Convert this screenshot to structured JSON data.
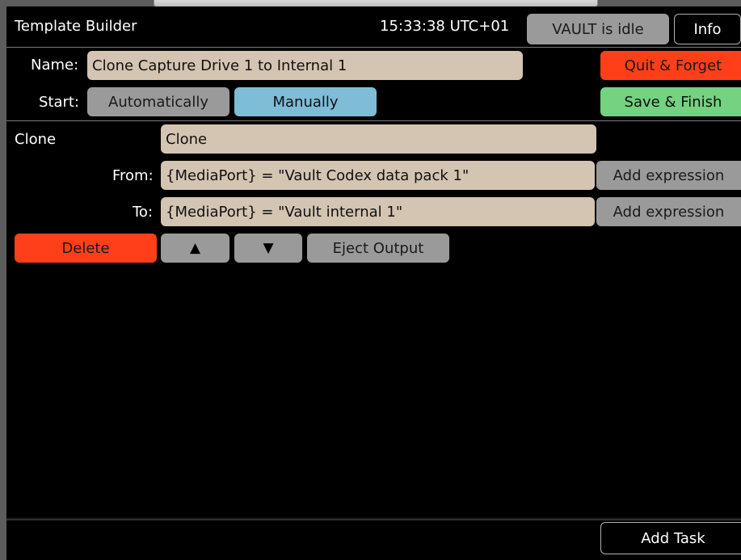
{
  "header": {
    "title": "Template Builder",
    "clock": "15:33:38 UTC+01",
    "status": "VAULT is idle",
    "info_label": "Info"
  },
  "name_row": {
    "label": "Name:",
    "value": "Clone Capture Drive 1 to Internal 1",
    "quit_label": "Quit & Forget"
  },
  "start_row": {
    "label": "Start:",
    "options": [
      "Automatically",
      "Manually"
    ],
    "selected": "Manually",
    "save_label": "Save & Finish"
  },
  "task": {
    "type_label": "Clone",
    "name_value": "Clone",
    "from_label": "From:",
    "from_value": "{MediaPort} = \"Vault Codex data pack 1\"",
    "to_label": "To:",
    "to_value": "{MediaPort} = \"Vault internal 1\"",
    "add_expression_label": "Add expression",
    "delete_label": "Delete",
    "move_up_glyph": "▲",
    "move_down_glyph": "▼",
    "eject_label": "Eject Output"
  },
  "footer": {
    "add_task_label": "Add Task"
  },
  "colors": {
    "field_bg": "#d4c4b2",
    "gray_button": "#9a9a9a",
    "selected_blue": "#7fbcd6",
    "danger_red": "#fe3f1a",
    "success_green": "#74d280"
  }
}
